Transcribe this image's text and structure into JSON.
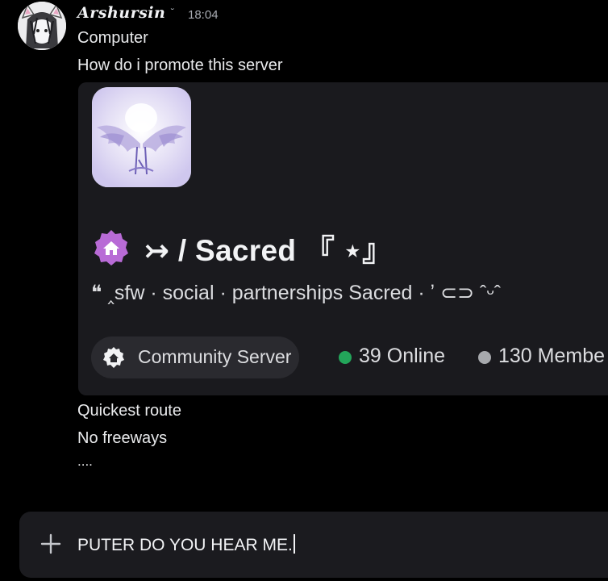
{
  "message": {
    "username": "Arshursin",
    "user_badge": "˘",
    "timestamp": "18:04",
    "lines_before": [
      "Computer",
      "How do i promote this server"
    ],
    "lines_after": [
      "Quickest route",
      "No freeways",
      "...."
    ]
  },
  "embed": {
    "server_name": "↣  / Sacred   『 ⋆』",
    "tags": "❝ ‸sfw · social · partnerships  Sacred ·  ʼ ⊂⊃ ˆᵕˆ",
    "community_label": "Community Server",
    "online": "39 Online",
    "members": "130 Membe",
    "online_color": "#23a55a",
    "members_color": "#a7a9ad",
    "home_badge_color": "#b86bd6"
  },
  "composer": {
    "value": "PUTER DO YOU HEAR ME."
  },
  "icons": {
    "avatar": "cat-ear-avatar-icon",
    "server": "angel-wings-server-icon",
    "home": "home-badge-icon",
    "community": "community-server-icon",
    "plus": "plus-icon"
  }
}
